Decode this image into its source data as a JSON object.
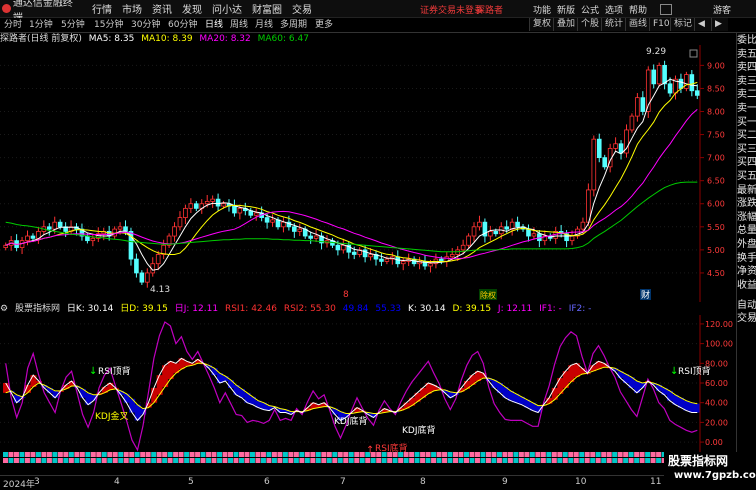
{
  "menubar": {
    "app_title": "通达信金融终端",
    "menus": [
      "行情",
      "市场",
      "资讯",
      "发现",
      "问小达",
      "财富圈",
      "交易"
    ],
    "warning": "证券交易未登录",
    "account": "探路者",
    "right_items": [
      "功能",
      "新版",
      "公式",
      "选项",
      "帮助"
    ],
    "guest": "游客"
  },
  "periods": [
    "分时",
    "1分钟",
    "5分钟",
    "15分钟",
    "30分钟",
    "60分钟",
    "日线",
    "周线",
    "月线",
    "多周期",
    "更多"
  ],
  "active_period": "日线",
  "toolbar_right": [
    "复权",
    "叠加",
    "个股",
    "统计",
    "画线",
    "F10",
    "标记"
  ],
  "main_chart": {
    "stock": "探路者(日线 前复权)",
    "ma5": "MA5: 8.35",
    "ma10": "MA10: 8.39",
    "ma20": "MA20: 8.32",
    "ma60": "MA60: 6.47",
    "colors": {
      "ma5": "#ffffff",
      "ma10": "#ffff00",
      "ma20": "#ff00ff",
      "ma60": "#00cc00",
      "up": "#ff3232",
      "down": "#54ffff"
    }
  },
  "sub_chart": {
    "title": "股票指标网",
    "fields": [
      "日K: 30.14",
      "日D: 39.15",
      "日J: 12.11",
      "RSI1: 42.46",
      "RSI2: 55.30",
      "49.84",
      "55.33",
      "K: 30.14",
      "D: 39.15",
      "J: 12.11",
      "IF1: -",
      "IF2: -"
    ],
    "annotations": {
      "rsi_top_left": "RSI顶背",
      "rsi_top_right": "RSI顶背",
      "kdj_gold": "KDJ金叉",
      "kdj_bottom1": "KDJ底背",
      "kdj_bottom2": "KDJ底背",
      "rsi_bottom": "RSI底背"
    }
  },
  "chart_data": [
    {
      "type": "candlestick",
      "title": "探路者(日线 前复权)",
      "y_ticks": [
        "9.00",
        "8.50",
        "8.00",
        "7.50",
        "7.00",
        "6.50",
        "6.00",
        "5.50",
        "5.00",
        "4.50"
      ],
      "ylim": [
        4.13,
        9.29
      ],
      "labels": {
        "high": "9.29",
        "low": "4.13"
      },
      "events": [
        "8",
        "除权",
        "财"
      ],
      "close": [
        5.1,
        5.2,
        5.05,
        5.2,
        5.3,
        5.25,
        5.4,
        5.5,
        5.45,
        5.6,
        5.5,
        5.4,
        5.5,
        5.45,
        5.3,
        5.2,
        5.25,
        5.35,
        5.4,
        5.3,
        5.45,
        5.5,
        5.4,
        4.8,
        4.5,
        4.3,
        4.5,
        4.7,
        4.9,
        5.1,
        5.3,
        5.5,
        5.7,
        5.9,
        6.0,
        5.9,
        6.0,
        6.05,
        6.1,
        5.95,
        6.0,
        5.95,
        5.8,
        5.9,
        5.85,
        5.75,
        5.8,
        5.7,
        5.6,
        5.65,
        5.5,
        5.6,
        5.5,
        5.4,
        5.45,
        5.3,
        5.25,
        5.3,
        5.15,
        5.2,
        5.1,
        5.0,
        5.1,
        4.95,
        4.9,
        5.0,
        4.85,
        4.9,
        4.8,
        4.75,
        4.8,
        4.85,
        4.7,
        4.75,
        4.8,
        4.7,
        4.75,
        4.65,
        4.7,
        4.8,
        4.75,
        4.85,
        4.9,
        5.0,
        5.1,
        5.3,
        5.5,
        5.6,
        5.3,
        5.4,
        5.35,
        5.5,
        5.45,
        5.6,
        5.5,
        5.45,
        5.3,
        5.35,
        5.2,
        5.3,
        5.25,
        5.4,
        5.35,
        5.2,
        5.3,
        5.45,
        5.6,
        6.3,
        7.4,
        7.0,
        6.8,
        7.2,
        7.3,
        7.1,
        7.6,
        7.9,
        8.3,
        8.0,
        8.9,
        8.6,
        9.0,
        8.6,
        8.4,
        8.7,
        8.5,
        8.8,
        8.45,
        8.35
      ],
      "ma60": [
        5.6,
        5.58,
        5.55,
        5.53,
        5.52,
        5.5,
        5.48,
        5.45,
        5.42,
        5.4,
        5.38,
        5.36,
        5.34,
        5.33,
        5.32,
        5.3,
        5.28,
        5.27,
        5.26,
        5.24,
        5.23,
        5.22,
        5.2,
        5.18,
        5.17,
        5.16,
        5.15,
        5.14,
        5.13,
        5.12,
        5.12,
        5.13,
        5.14,
        5.15,
        5.16,
        5.17,
        5.18,
        5.19,
        5.2,
        5.21,
        5.22,
        5.22,
        5.23,
        5.23,
        5.24,
        5.24,
        5.24,
        5.24,
        5.24,
        5.23,
        5.23,
        5.22,
        5.22,
        5.21,
        5.21,
        5.2,
        5.2,
        5.19,
        5.18,
        5.17,
        5.16,
        5.15,
        5.14,
        5.13,
        5.12,
        5.11,
        5.1,
        5.09,
        5.08,
        5.07,
        5.06,
        5.05,
        5.04,
        5.03,
        5.02,
        5.01,
        5.0,
        4.99,
        4.98,
        4.97,
        4.96,
        4.96,
        4.96,
        4.96,
        4.97,
        4.98,
        4.99,
        5.0,
        5.0,
        5.0,
        5.0,
        5.01,
        5.01,
        5.02,
        5.02,
        5.02,
        5.02,
        5.02,
        5.02,
        5.02,
        5.02,
        5.02,
        5.02,
        5.02,
        5.03,
        5.05,
        5.08,
        5.15,
        5.25,
        5.33,
        5.4,
        5.48,
        5.56,
        5.64,
        5.74,
        5.84,
        5.94,
        6.03,
        6.12,
        6.2,
        6.28,
        6.35,
        6.4,
        6.44,
        6.46,
        6.47,
        6.47,
        6.47
      ]
    },
    {
      "type": "line",
      "title": "股票指标网",
      "y_ticks": [
        "120.00",
        "100.00",
        "80.00",
        "60.00",
        "40.00",
        "20.00",
        "0.00"
      ],
      "ylim": [
        -5,
        125
      ],
      "series": [
        {
          "name": "K",
          "values": [
            60,
            50,
            40,
            45,
            58,
            68,
            62,
            55,
            50,
            45,
            52,
            58,
            62,
            55,
            45,
            38,
            42,
            50,
            56,
            60,
            55,
            48,
            40,
            30,
            22,
            28,
            40,
            55,
            68,
            78,
            82,
            80,
            85,
            82,
            80,
            84,
            80,
            75,
            68,
            60,
            62,
            55,
            48,
            45,
            40,
            38,
            35,
            33,
            32,
            35,
            30,
            30,
            28,
            32,
            30,
            35,
            40,
            38,
            40,
            35,
            28,
            22,
            25,
            30,
            35,
            32,
            28,
            25,
            30,
            34,
            32,
            30,
            35,
            40,
            45,
            50,
            55,
            60,
            58,
            55,
            50,
            45,
            48,
            55,
            62,
            68,
            72,
            70,
            62,
            55,
            50,
            45,
            42,
            40,
            38,
            35,
            32,
            30,
            38,
            45,
            55,
            65,
            72,
            78,
            80,
            75,
            70,
            78,
            82,
            80,
            76,
            72,
            65,
            60,
            55,
            50,
            55,
            62,
            58,
            52,
            48,
            42,
            38,
            35,
            32,
            30,
            30
          ]
        },
        {
          "name": "D",
          "values": [
            50,
            52,
            48,
            46,
            50,
            56,
            60,
            58,
            55,
            52,
            52,
            54,
            57,
            57,
            54,
            50,
            48,
            48,
            50,
            53,
            54,
            52,
            49,
            44,
            38,
            34,
            35,
            40,
            48,
            56,
            64,
            70,
            74,
            77,
            78,
            80,
            80,
            78,
            75,
            70,
            67,
            63,
            58,
            54,
            50,
            46,
            42,
            40,
            37,
            36,
            34,
            33,
            31,
            31,
            31,
            32,
            34,
            35,
            36,
            36,
            34,
            31,
            29,
            29,
            30,
            31,
            30,
            29,
            29,
            30,
            31,
            31,
            32,
            34,
            37,
            41,
            45,
            49,
            52,
            53,
            53,
            51,
            50,
            51,
            54,
            58,
            62,
            65,
            65,
            63,
            60,
            56,
            52,
            49,
            46,
            43,
            40,
            37,
            37,
            39,
            43,
            49,
            55,
            61,
            66,
            69,
            70,
            72,
            74,
            76,
            76,
            75,
            72,
            69,
            66,
            62,
            60,
            61,
            60,
            58,
            55,
            52,
            48,
            45,
            42,
            40,
            39
          ]
        },
        {
          "name": "J",
          "values": [
            80,
            45,
            25,
            40,
            75,
            90,
            68,
            50,
            40,
            30,
            52,
            66,
            72,
            50,
            28,
            15,
            30,
            55,
            68,
            75,
            57,
            40,
            22,
            2,
            -8,
            16,
            50,
            85,
            108,
            122,
            118,
            100,
            107,
            92,
            84,
            92,
            80,
            68,
            55,
            40,
            50,
            39,
            28,
            27,
            20,
            22,
            21,
            19,
            22,
            33,
            22,
            24,
            22,
            34,
            28,
            41,
            52,
            44,
            48,
            33,
            16,
            4,
            17,
            32,
            45,
            34,
            24,
            17,
            32,
            42,
            34,
            28,
            41,
            52,
            61,
            68,
            75,
            82,
            70,
            59,
            44,
            33,
            44,
            63,
            78,
            88,
            92,
            80,
            56,
            39,
            30,
            23,
            22,
            22,
            22,
            19,
            16,
            16,
            40,
            57,
            79,
            97,
            106,
            112,
            108,
            87,
            70,
            90,
            98,
            88,
            76,
            66,
            51,
            42,
            33,
            26,
            45,
            64,
            54,
            40,
            34,
            22,
            18,
            15,
            12,
            10,
            12
          ]
        }
      ]
    }
  ],
  "bottom": {
    "axis_dates": [
      "2024年",
      "3",
      "4",
      "5",
      "6",
      "7",
      "8",
      "9",
      "10",
      "11"
    ]
  },
  "side_panel": {
    "top_items": [
      "委比",
      "卖五",
      "卖四",
      "卖三",
      "卖二",
      "卖一",
      "买一",
      "买二",
      "买三",
      "买四",
      "买五",
      "最新",
      "涨跌",
      "涨幅",
      "总量",
      "外盘",
      "换手",
      "净资",
      "收益"
    ],
    "bottom_items": [
      "自动",
      "交易"
    ]
  },
  "watermark": {
    "line1": "股票指标网",
    "line2": "www.7gpzb.com"
  }
}
